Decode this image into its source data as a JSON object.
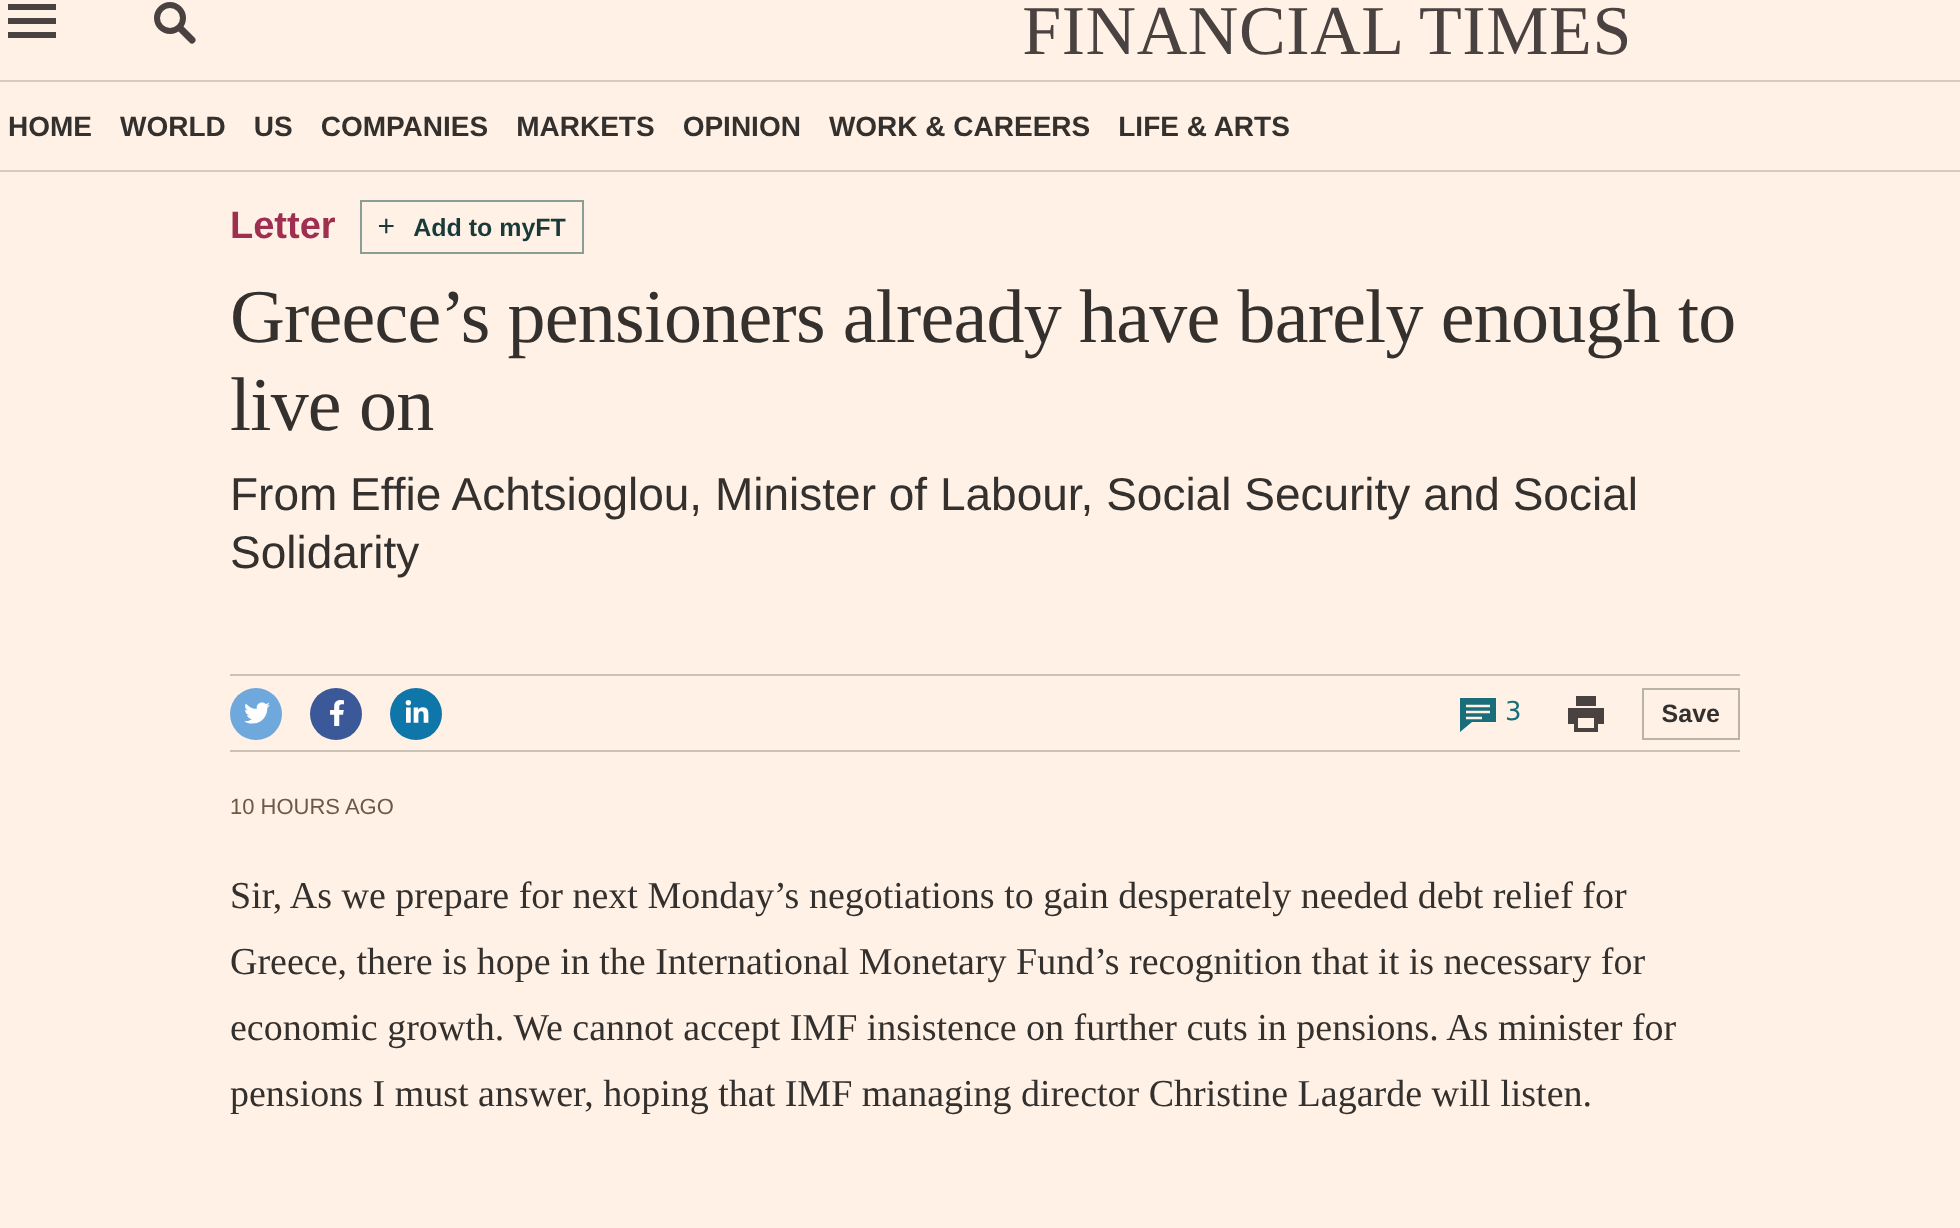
{
  "masthead": {
    "title": "FINANCIAL TIMES"
  },
  "nav": [
    {
      "label": "HOME"
    },
    {
      "label": "WORLD"
    },
    {
      "label": "US"
    },
    {
      "label": "COMPANIES"
    },
    {
      "label": "MARKETS"
    },
    {
      "label": "OPINION"
    },
    {
      "label": "WORK & CAREERS"
    },
    {
      "label": "LIFE & ARTS"
    }
  ],
  "article": {
    "section": "Letter",
    "follow_button": {
      "icon": "+",
      "label": "Add to myFT"
    },
    "headline": "Greece’s pensioners already have barely enough to live on",
    "standfirst": "From Effie Achtsioglou, Minister of Labour, Social Security and Social Solidarity",
    "share": [
      {
        "kind": "twitter"
      },
      {
        "kind": "facebook"
      },
      {
        "kind": "linkedin"
      }
    ],
    "comments": "3",
    "save_button": "Save",
    "timestamp": "10 HOURS AGO",
    "body": "Sir, As we prepare for next Monday’s negotiations to gain desperately needed debt relief for Greece, there is hope in the International Monetary Fund’s recognition that it is necessary for economic growth. We cannot accept IMF insistence on further cuts in pensions. As minister for pensions I must answer, hoping that IMF managing director Christine Lagarde will listen."
  }
}
